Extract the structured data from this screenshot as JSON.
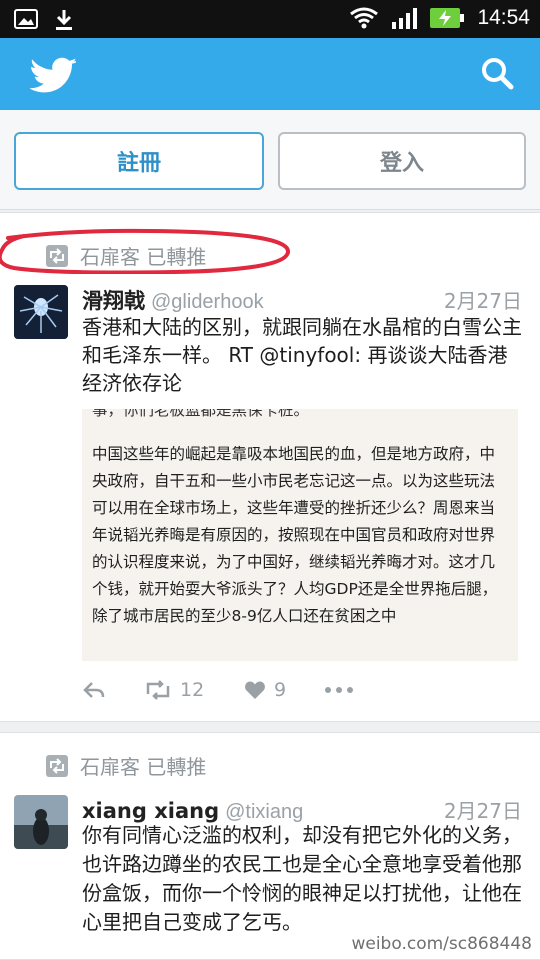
{
  "status": {
    "time": "14:54"
  },
  "auth": {
    "signup_label": "註冊",
    "login_label": "登入"
  },
  "tweets": [
    {
      "retweeted_by": "石扉客 已轉推",
      "name": "滑翔戟",
      "handle": "@gliderhook",
      "date": "2月27日",
      "text": "香港和大陆的区别，就跟同躺在水晶棺的白雪公主和毛泽东一样。 RT @tinyfool: 再谈谈大陆香港经济依存论",
      "embed_text": "中国这些年的崛起是靠吸本地国民的血，但是地方政府，中央政府，自干五和一些小市民老忘记这一点。以为这些玩法可以用在全球市场上，这些年遭受的挫折还少么？周恩来当年说韬光养晦是有原因的，按照现在中国官员和政府对世界的认识程度来说，为了中国好，继续韬光养晦才对。这才几个钱，就开始耍大爷派头了？人均GDP还是全世界拖后腿，除了城市居民的至少8-9亿人口还在贫困之中",
      "embed_cut_top": "事，你们老板蓝都是黑保卡桩。",
      "retweet_count": "12",
      "like_count": "9"
    },
    {
      "retweeted_by": "石扉客 已轉推",
      "name": "xiang xiang",
      "handle": "@tixiang",
      "date": "2月27日",
      "text": "你有同情心泛滥的权利，却没有把它外化的义务，也许路边蹲坐的农民工也是全心全意地享受着他那份盒饭，而你一个怜悯的眼神足以打扰他，让他在心里把自己变成了乞丐。"
    }
  ],
  "watermark": "weibo.com/sc868448",
  "colors": {
    "twitter_blue": "#35aaea",
    "annotation_red": "#e0283f",
    "signup_blue": "#2e90c9"
  }
}
